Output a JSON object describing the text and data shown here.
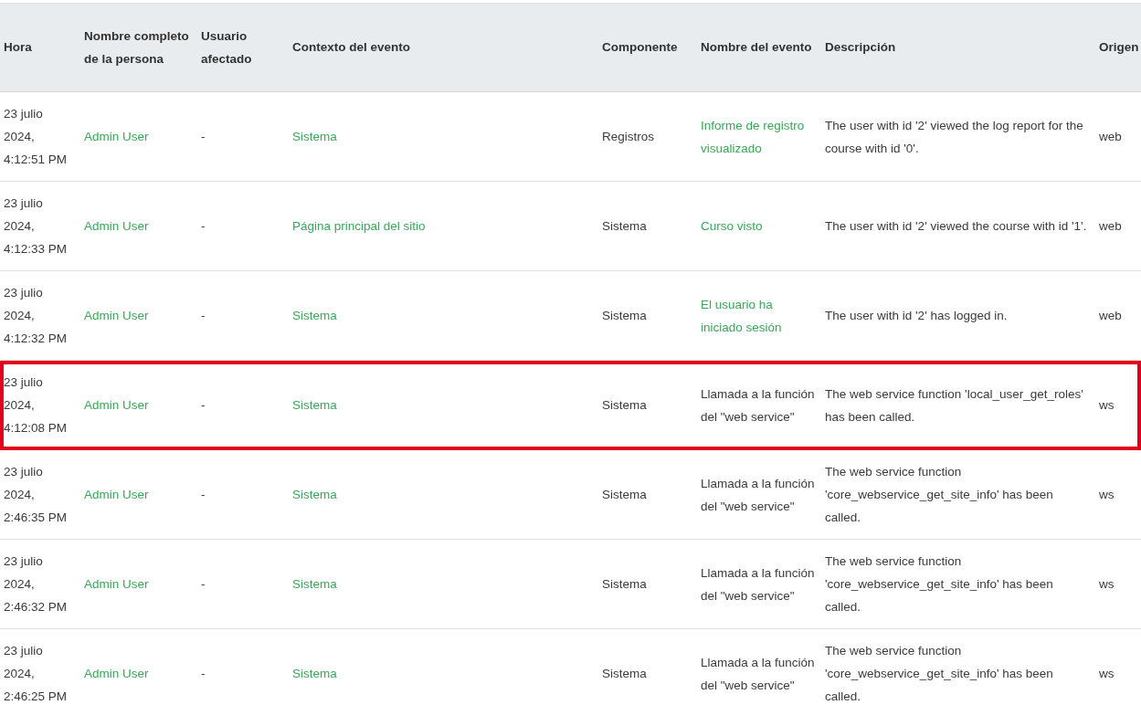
{
  "table": {
    "columns": [
      "Hora",
      "Nombre completo de la persona",
      "Usuario afectado",
      "Contexto del evento",
      "Componente",
      "Nombre del evento",
      "Descripción",
      "Origen"
    ],
    "rows": [
      {
        "time": "23 julio 2024, 4:12:51 PM",
        "person": "Admin User",
        "affected": "-",
        "context": "Sistema",
        "component": "Registros",
        "event": "Informe de registro visualizado",
        "event_link": true,
        "description": "The user with id '2' viewed the log report for the course with id '0'.",
        "origin": "web",
        "highlighted": false
      },
      {
        "time": "23 julio 2024, 4:12:33 PM",
        "person": "Admin User",
        "affected": "-",
        "context": "Página principal del sitio",
        "component": "Sistema",
        "event": "Curso visto",
        "event_link": true,
        "description": "The user with id '2' viewed the course with id '1'.",
        "origin": "web",
        "highlighted": false
      },
      {
        "time": "23 julio 2024, 4:12:32 PM",
        "person": "Admin User",
        "affected": "-",
        "context": "Sistema",
        "component": "Sistema",
        "event": "El usuario ha iniciado sesión",
        "event_link": true,
        "description": "The user with id '2' has logged in.",
        "origin": "web",
        "highlighted": false
      },
      {
        "time": "23 julio 2024, 4:12:08 PM",
        "person": "Admin User",
        "affected": "-",
        "context": "Sistema",
        "component": "Sistema",
        "event": "Llamada a la función del \"web service\"",
        "event_link": false,
        "description": "The web service function 'local_user_get_roles' has been called.",
        "origin": "ws",
        "highlighted": true
      },
      {
        "time": "23 julio 2024, 2:46:35 PM",
        "person": "Admin User",
        "affected": "-",
        "context": "Sistema",
        "component": "Sistema",
        "event": "Llamada a la función del \"web service\"",
        "event_link": false,
        "description": "The web service function 'core_webservice_get_site_info' has been called.",
        "origin": "ws",
        "highlighted": false
      },
      {
        "time": "23 julio 2024, 2:46:32 PM",
        "person": "Admin User",
        "affected": "-",
        "context": "Sistema",
        "component": "Sistema",
        "event": "Llamada a la función del \"web service\"",
        "event_link": false,
        "description": "The web service function 'core_webservice_get_site_info' has been called.",
        "origin": "ws",
        "highlighted": false
      },
      {
        "time": "23 julio 2024, 2:46:25 PM",
        "person": "Admin User",
        "affected": "-",
        "context": "Sistema",
        "component": "Sistema",
        "event": "Llamada a la función del \"web service\"",
        "event_link": false,
        "description": "The web service function 'core_webservice_get_site_info' has been called.",
        "origin": "ws",
        "highlighted": false
      }
    ]
  }
}
